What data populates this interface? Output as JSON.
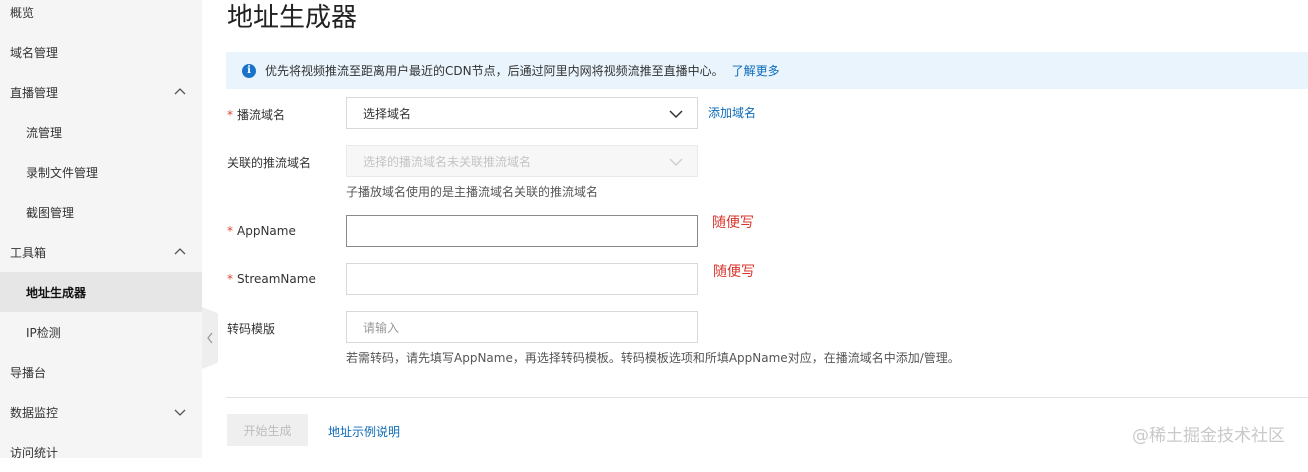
{
  "sidebar": {
    "items": [
      {
        "label": "概览"
      },
      {
        "label": "域名管理"
      },
      {
        "label": "直播管理"
      },
      {
        "label": "流管理"
      },
      {
        "label": "录制文件管理"
      },
      {
        "label": "截图管理"
      },
      {
        "label": "工具箱"
      },
      {
        "label": "地址生成器"
      },
      {
        "label": "IP检测"
      },
      {
        "label": "导播台"
      },
      {
        "label": "数据监控"
      },
      {
        "label": "访问统计"
      }
    ],
    "active_item": "地址生成器",
    "active_bg": "#e6e6e6"
  },
  "page": {
    "title": "地址生成器"
  },
  "notice": {
    "text": "优先将视频推流至距离用户最近的CDN节点，后通过阿里内网将视频流推至直播中心。",
    "link": "了解更多",
    "bg": "#e9f4fd"
  },
  "form": {
    "play_domain": {
      "label": "播流域名",
      "value": "选择域名",
      "add_link": "添加域名"
    },
    "push_domain": {
      "label": "关联的推流域名",
      "placeholder": "选择的播流域名未关联推流域名",
      "hint": "子播放域名使用的是主播流域名关联的推流域名"
    },
    "app_name": {
      "label": "AppName",
      "value": "",
      "note": "随便写"
    },
    "stream_name": {
      "label": "StreamName",
      "value": "",
      "note": "随便写"
    },
    "transcode": {
      "label": "转码模版",
      "placeholder": "请输入",
      "hint": "若需转码，请先填写AppName，再选择转码模板。转码模板选项和所填AppName对应，在播流域名中添加/管理。"
    },
    "required_mark": "*"
  },
  "actions": {
    "generate": "开始生成",
    "example_link": "地址示例说明"
  },
  "watermark": "@稀土掘金技术社区",
  "colors": {
    "link": "#0b6ab8",
    "required": "#e0473b",
    "note": "#d9342b"
  }
}
